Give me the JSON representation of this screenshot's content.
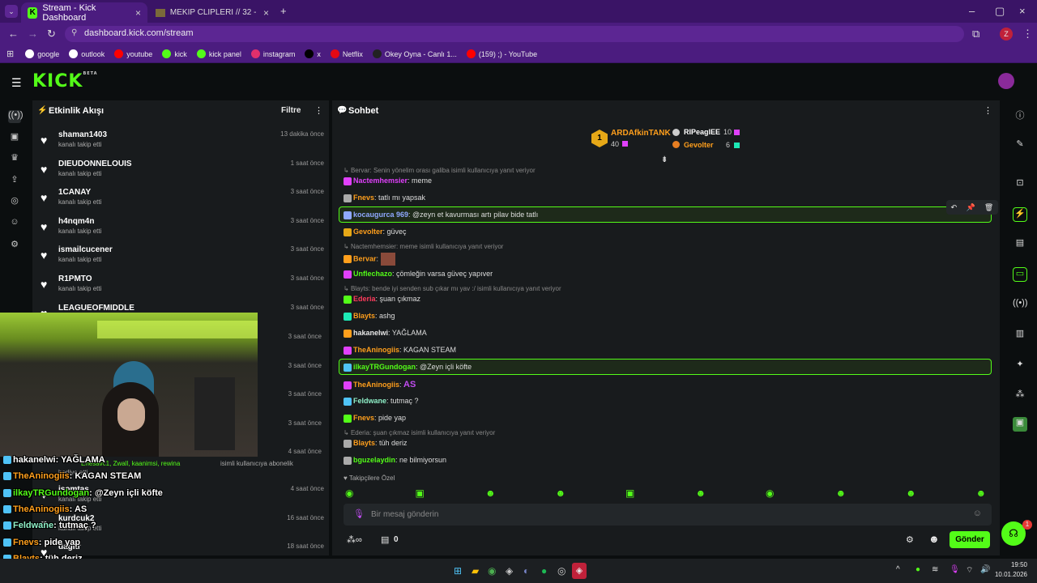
{
  "browser": {
    "tabs": [
      {
        "label": "Stream - Kick Dashboard"
      },
      {
        "label": "MEKİP CLİPLERİ // 32 - Tier List"
      }
    ],
    "url": "dashboard.kick.com/stream",
    "profile_initial": "Z",
    "bookmarks": [
      {
        "label": "google",
        "color": "#ffffff"
      },
      {
        "label": "outlook",
        "color": "#ffffff"
      },
      {
        "label": "youtube",
        "color": "#ff0000"
      },
      {
        "label": "kick",
        "color": "#53fc18"
      },
      {
        "label": "kick panel",
        "color": "#53fc18"
      },
      {
        "label": "instagram",
        "color": "#e1306c"
      },
      {
        "label": "x",
        "color": "#000000"
      },
      {
        "label": "Netflix",
        "color": "#e50914"
      },
      {
        "label": "Okey Oyna - Canlı 1...",
        "color": "#222222"
      },
      {
        "label": "(159) ;) - YouTube",
        "color": "#ff0000"
      }
    ]
  },
  "app": {
    "logo": "KICK",
    "logo_tag": "BETA",
    "accent": "#53fc18"
  },
  "activity": {
    "title": "Etkinlik Akışı",
    "filter_label": "Filtre",
    "items": [
      {
        "user": "shaman1403",
        "action": "kanalı takip etti",
        "time": "13 dakika önce"
      },
      {
        "user": "DIEUDONNELOUIS",
        "action": "kanalı takip etti",
        "time": "1 saat önce"
      },
      {
        "user": "1CANAY",
        "action": "kanalı takip etti",
        "time": "3 saat önce"
      },
      {
        "user": "h4nqm4n",
        "action": "kanalı takip etti",
        "time": "3 saat önce"
      },
      {
        "user": "ismailcucener",
        "action": "kanalı takip etti",
        "time": "3 saat önce"
      },
      {
        "user": "R1PMTO",
        "action": "kanalı takip etti",
        "time": "3 saat önce"
      },
      {
        "user": "LEAGUEOFMIDDLE",
        "action": "",
        "time": "3 saat önce"
      }
    ],
    "hidden_times": [
      "3 saat önce",
      "3 saat önce",
      "3 saat önce",
      "3 saat önce",
      "4 saat önce"
    ],
    "sub_line": "isimli kullanıcıya abonelik",
    "sub_names": "Enesavc1, Zwall, kaanimsi, rewina",
    "sub_prefix": "bediye etti",
    "bottom_items": [
      {
        "user": "isomtas",
        "action": "kanalı takip etti",
        "time": "4 saat önce"
      },
      {
        "user": "kurdcuk2",
        "action": "kanalı takip etti",
        "time": "16 saat önce"
      },
      {
        "user": "dagitr",
        "action": "",
        "time": "18 saat önce"
      }
    ]
  },
  "chat": {
    "title": "Sohbet",
    "leaders": [
      {
        "rank": "1",
        "name": "ARDAfkinTANK",
        "count": "40"
      },
      {
        "rank": "2",
        "name": "RIPeaglEE",
        "count": "10"
      },
      {
        "rank": "3",
        "name": "Gevolter",
        "count": "6"
      }
    ],
    "messages": [
      {
        "reply": "Bervar: Senin yönelim orası galiba",
        "reply_suffix": "isimli kullanıcıya yanıt veriyor"
      },
      {
        "user": "Nactemhemsier",
        "text": ": meme",
        "color": "#e040fb"
      },
      {
        "user": "Fnevs",
        "text": ": tatlı mı yapsak",
        "color": "#ff9f1c"
      },
      {
        "user": "kocaugurca 969",
        "text": ": @zeyn et kavurması artı pilav bide tatlı",
        "color": "#8fa8ff"
      },
      {
        "user": "Gevolter",
        "text": ": güveç",
        "color": "#ff9f1c"
      },
      {
        "reply": "Nactemhemsier: meme",
        "reply_suffix": "isimli kullanıcıya yanıt veriyor"
      },
      {
        "user": "Bervar",
        "text": ":",
        "color": "#ff9f1c"
      },
      {
        "user": "Unflechazo",
        "text": ": çömleğin varsa güveç yapıver",
        "color": "#53fc18"
      },
      {
        "reply": "Blayts: bende iyi senden sub çıkar mı yav :/",
        "reply_suffix": "isimli kullanıcıya yanıt veriyor"
      },
      {
        "user": "Ederia",
        "text": ": şuan çıkmaz",
        "color": "#ff3b5c"
      },
      {
        "user": "Blayts",
        "text": ": ashg",
        "color": "#ff9f1c"
      },
      {
        "user": "hakanelwi",
        "text": ": YAĞLAMA",
        "color": "#e8e8e8"
      },
      {
        "user": "TheAninogiis",
        "text": ": KAGAN STEAM",
        "color": "#ff9f1c"
      },
      {
        "user": "ilkayTRGundogan",
        "text": ": @Zeyn içli köfte",
        "color": "#53fc18"
      },
      {
        "user": "TheAninogiis",
        "text": ":",
        "color": "#ff9f1c",
        "emote": "AS"
      },
      {
        "user": "Feldwane",
        "text": ": tutmaç ?",
        "color": "#8ff0c8"
      },
      {
        "user": "Fnevs",
        "text": ": pide yap",
        "color": "#ff9f1c"
      },
      {
        "reply": "Ederia: şuan çıkmaz",
        "reply_suffix": "isimli kullanıcıya yanıt veriyor"
      },
      {
        "user": "Blayts",
        "text": ": tüh deriz",
        "color": "#ff9f1c"
      },
      {
        "user": "bguzelaydin",
        "text": ": ne bilmiyorsun",
        "color": "#53fc18"
      }
    ],
    "emote_section": "Takipçilere Özel",
    "input_placeholder": "Bir mesaj gönderin",
    "points": "0",
    "send_label": "Gönder"
  },
  "overlay": [
    {
      "user": "hakanelwi",
      "text": ": YAĞLAMA",
      "color": "#ffffff"
    },
    {
      "user": "TheAninogiis",
      "text": ": KAGAN STEAM",
      "color": "#ff9f1c"
    },
    {
      "user": "ilkayTRGundogan",
      "text": ": @Zeyn içli köfte",
      "color": "#53fc18"
    },
    {
      "user": "TheAninogiis",
      "text": ": AS",
      "color": "#ff9f1c"
    },
    {
      "user": "Feldwane",
      "text": ": tutmaç ?",
      "color": "#8ff0c8"
    },
    {
      "user": "Fnevs",
      "text": ": pide yap",
      "color": "#ff9f1c"
    },
    {
      "user": "Blayts",
      "text": ": tüh deriz",
      "color": "#ff9f1c"
    },
    {
      "user": "bguzelaydin",
      "text": ": ne bilmiyorsun",
      "color": "#53fc18"
    }
  ],
  "taskbar": {
    "time": "19:50",
    "date": "10.01.2026"
  },
  "notif_count": "1"
}
